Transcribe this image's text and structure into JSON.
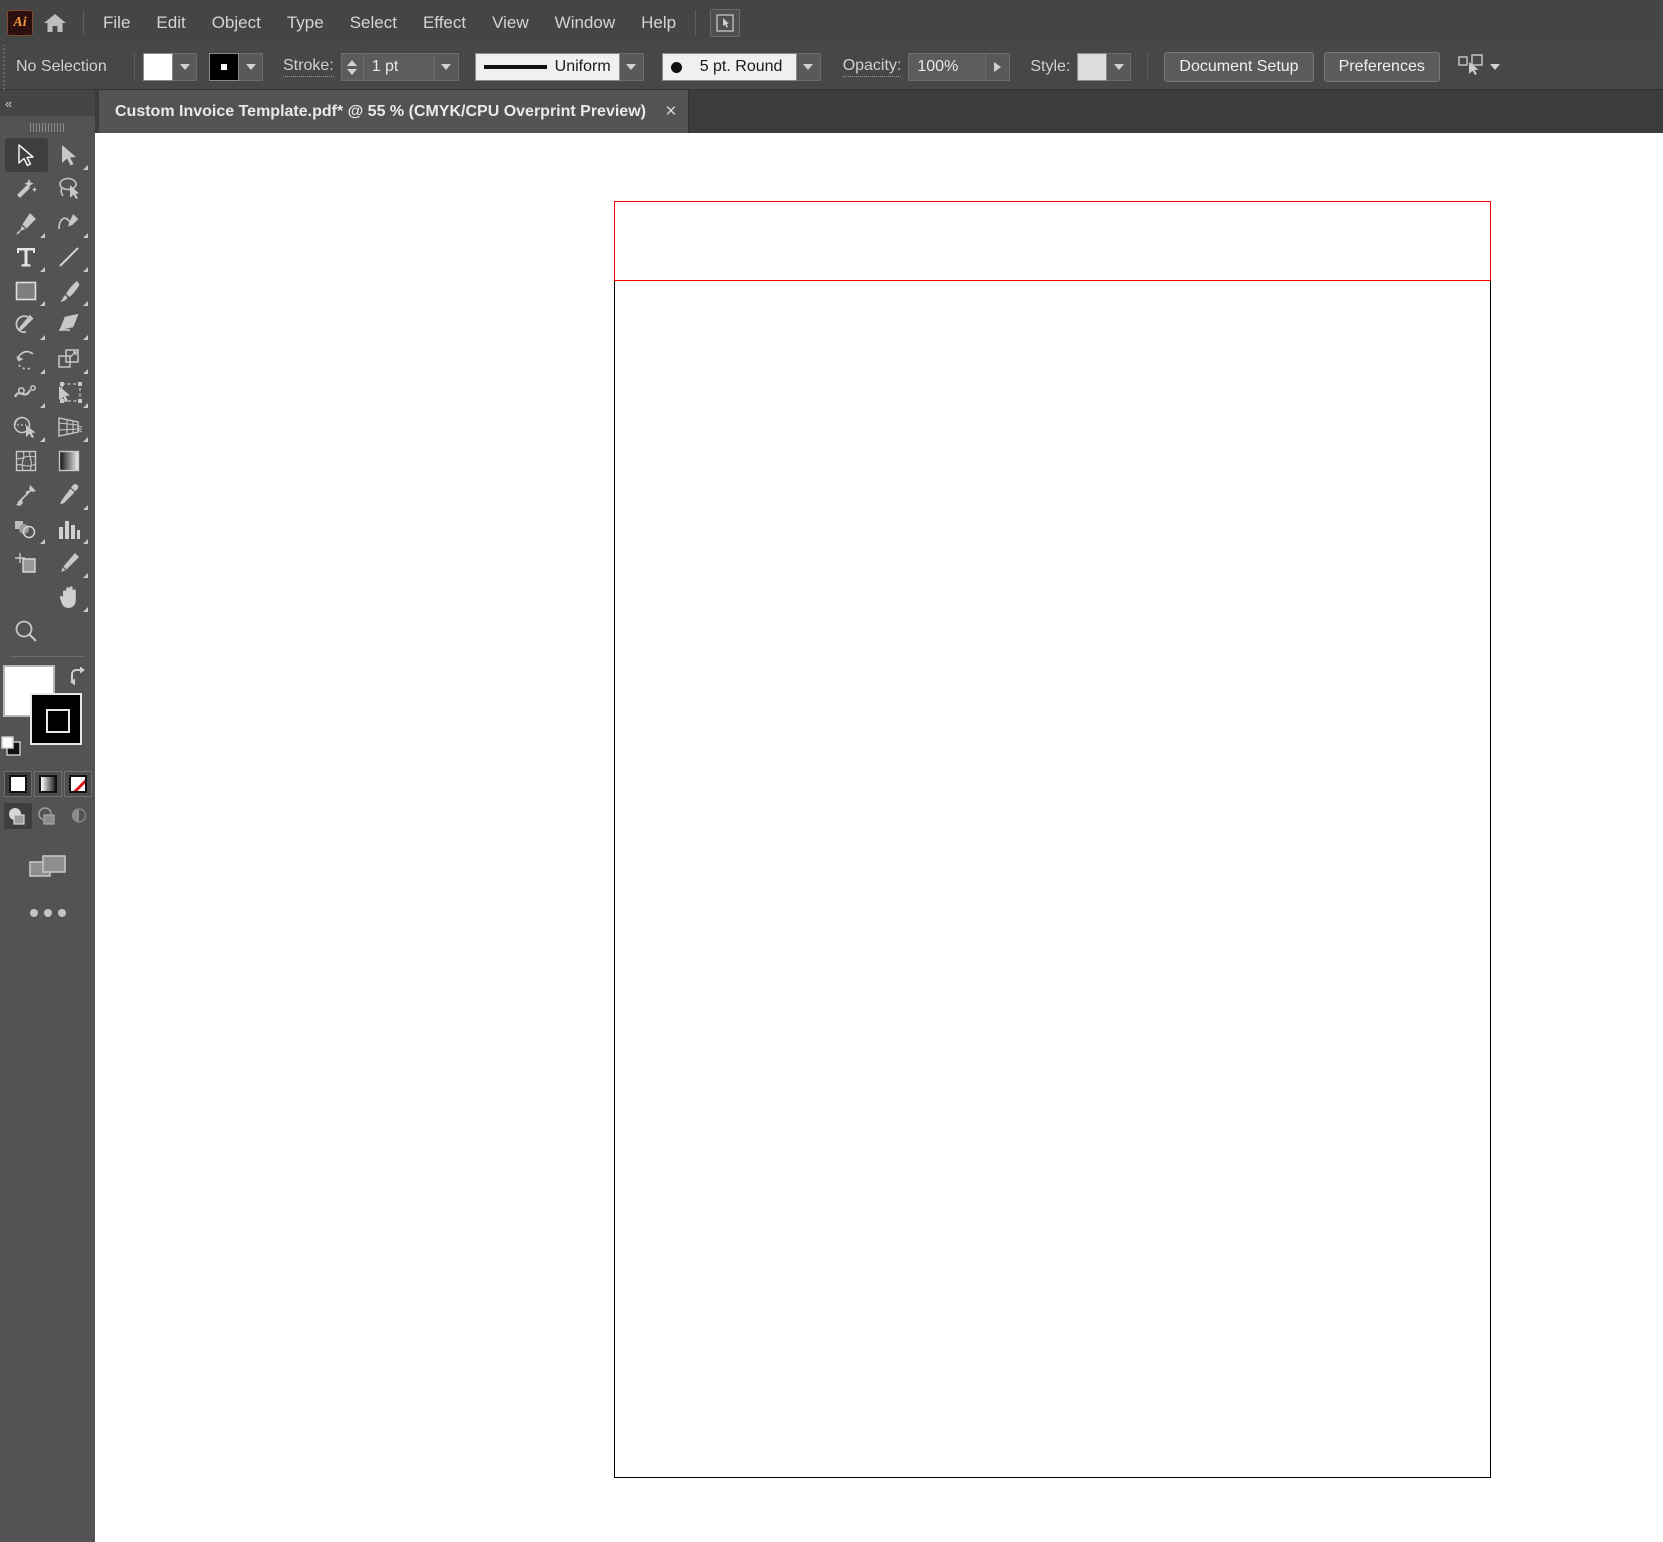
{
  "app": {
    "name": "Adobe Illustrator",
    "logo_text": "Ai",
    "logo_icon": "illustrator-logo-icon",
    "home_icon": "home-icon",
    "doc_mode_icon": "touch-type-mode-icon"
  },
  "menubar": {
    "items": [
      {
        "label": "File"
      },
      {
        "label": "Edit"
      },
      {
        "label": "Object"
      },
      {
        "label": "Type"
      },
      {
        "label": "Select"
      },
      {
        "label": "Effect"
      },
      {
        "label": "View"
      },
      {
        "label": "Window"
      },
      {
        "label": "Help"
      }
    ]
  },
  "controlbar": {
    "selection_status": "No Selection",
    "fill_swatch_name": "fill-color-white",
    "stroke_swatch_name": "stroke-color-black",
    "stroke_label": "Stroke:",
    "stroke_weight": "1 pt",
    "stroke_profile": "Uniform",
    "brush_definition": "5 pt. Round",
    "opacity_label": "Opacity:",
    "opacity_value": "100%",
    "style_label": "Style:",
    "document_setup_label": "Document Setup",
    "preferences_label": "Preferences",
    "align_icon": "align-to-selection-icon"
  },
  "tabbar": {
    "document_title": "Custom Invoice Template.pdf* @ 55 % (CMYK/CPU Overprint Preview)",
    "close_glyph": "×"
  },
  "toolpanel": {
    "collapse_glyph": "«",
    "tools": [
      {
        "name": "selection-tool",
        "active": true,
        "has_flyout": false
      },
      {
        "name": "direct-selection-tool",
        "active": false,
        "has_flyout": true
      },
      {
        "name": "magic-wand-tool",
        "active": false,
        "has_flyout": false
      },
      {
        "name": "lasso-tool",
        "active": false,
        "has_flyout": false
      },
      {
        "name": "pen-tool",
        "active": false,
        "has_flyout": true
      },
      {
        "name": "curvature-tool",
        "active": false,
        "has_flyout": false
      },
      {
        "name": "type-tool",
        "active": false,
        "has_flyout": true
      },
      {
        "name": "line-segment-tool",
        "active": false,
        "has_flyout": true
      },
      {
        "name": "rectangle-tool",
        "active": false,
        "has_flyout": true
      },
      {
        "name": "paintbrush-tool",
        "active": false,
        "has_flyout": true
      },
      {
        "name": "shaper-tool",
        "active": false,
        "has_flyout": true
      },
      {
        "name": "eraser-tool",
        "active": false,
        "has_flyout": true
      },
      {
        "name": "rotate-tool",
        "active": false,
        "has_flyout": true
      },
      {
        "name": "scale-tool",
        "active": false,
        "has_flyout": true
      },
      {
        "name": "width-tool",
        "active": false,
        "has_flyout": true
      },
      {
        "name": "free-transform-tool",
        "active": false,
        "has_flyout": true
      },
      {
        "name": "shape-builder-tool",
        "active": false,
        "has_flyout": true
      },
      {
        "name": "perspective-grid-tool",
        "active": false,
        "has_flyout": true
      },
      {
        "name": "mesh-tool",
        "active": false,
        "has_flyout": false
      },
      {
        "name": "gradient-tool",
        "active": false,
        "has_flyout": false
      },
      {
        "name": "blend-tool",
        "active": false,
        "has_flyout": false
      },
      {
        "name": "eyedropper-tool",
        "active": false,
        "has_flyout": true
      },
      {
        "name": "symbol-sprayer-tool",
        "active": false,
        "has_flyout": true
      },
      {
        "name": "column-graph-tool",
        "active": false,
        "has_flyout": true
      },
      {
        "name": "artboard-tool",
        "active": false,
        "has_flyout": false
      },
      {
        "name": "slice-tool",
        "active": false,
        "has_flyout": true
      },
      {
        "name": "hand-tool",
        "active": false,
        "has_flyout": true
      },
      {
        "name": "zoom-tool",
        "active": false,
        "has_flyout": false
      }
    ],
    "fill_color": "#ffffff",
    "stroke_color": "#000000",
    "fill_swatch_name": "fill-swatch",
    "stroke_swatch_name": "stroke-swatch",
    "swap_icon": "swap-fill-stroke-icon",
    "default_icon": "default-fill-stroke-icon",
    "color_modes": [
      {
        "name": "color-mode-button",
        "selected": true
      },
      {
        "name": "gradient-mode-button",
        "selected": false
      },
      {
        "name": "none-mode-button",
        "selected": false
      }
    ],
    "draw_modes": [
      {
        "name": "draw-normal-button",
        "selected": true
      },
      {
        "name": "draw-behind-button",
        "selected": false
      },
      {
        "name": "draw-inside-button",
        "selected": false
      }
    ],
    "screen_mode_icon": "change-screen-mode-icon",
    "edit_toolbar_icon": "edit-toolbar-icon"
  },
  "canvas": {
    "artboard_name": "artboard",
    "artboard_bg": "#ffffff",
    "artboard_border": "#000000",
    "selection_rect_color": "#ff0000",
    "selection_rect_name": "selected-path-bounds"
  }
}
